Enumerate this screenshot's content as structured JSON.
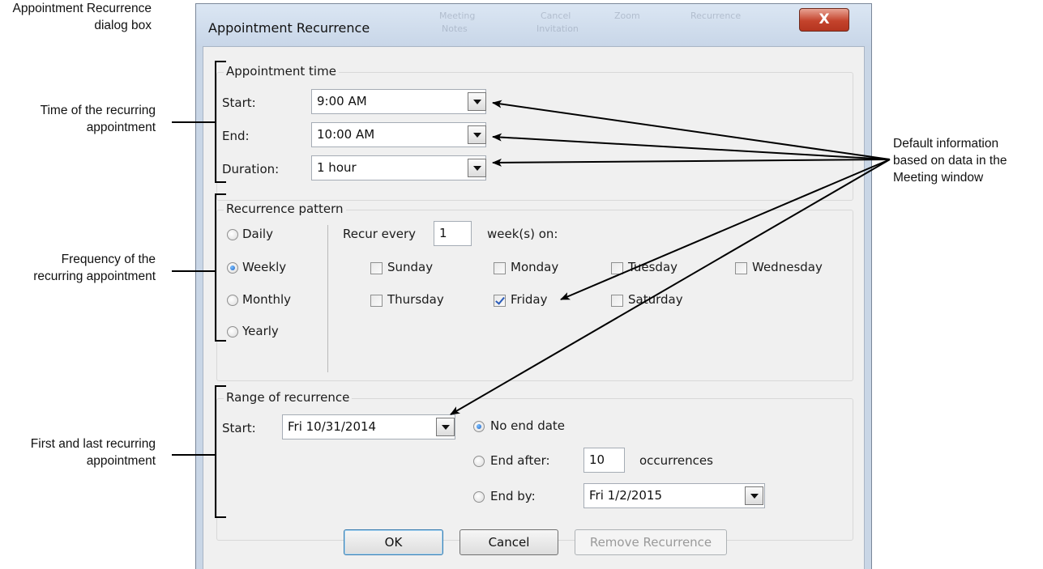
{
  "annotations": {
    "dialog_name": [
      "Appointment Recurrence",
      "dialog box"
    ],
    "time": [
      "Time of the recurring",
      "appointment"
    ],
    "frequency": [
      "Frequency of the",
      "recurring appointment"
    ],
    "range": [
      "First and last recurring",
      "appointment"
    ],
    "default_info": [
      "Default information",
      "based on data in the",
      "Meeting window"
    ]
  },
  "background_ribbon": [
    "Meeting",
    "Notes",
    "Cancel",
    "Invitation",
    "Zoom",
    "Recurrence"
  ],
  "dialog": {
    "title": "Appointment Recurrence",
    "close_label": "X",
    "appointment_time": {
      "group_label": "Appointment time",
      "start_label": "Start:",
      "start_value": "9:00 AM",
      "end_label": "End:",
      "end_value": "10:00 AM",
      "duration_label": "Duration:",
      "duration_value": "1 hour"
    },
    "recurrence_pattern": {
      "group_label": "Recurrence pattern",
      "options": [
        "Daily",
        "Weekly",
        "Monthly",
        "Yearly"
      ],
      "selected": "Weekly",
      "recur_every_label": "Recur every",
      "recur_every_value": "1",
      "weeks_on_label": "week(s) on:",
      "days": [
        {
          "label": "Sunday",
          "checked": false
        },
        {
          "label": "Monday",
          "checked": false
        },
        {
          "label": "Tuesday",
          "checked": false
        },
        {
          "label": "Wednesday",
          "checked": false
        },
        {
          "label": "Thursday",
          "checked": false
        },
        {
          "label": "Friday",
          "checked": true
        },
        {
          "label": "Saturday",
          "checked": false
        }
      ]
    },
    "range_of_recurrence": {
      "group_label": "Range of recurrence",
      "start_label": "Start:",
      "start_value": "Fri 10/31/2014",
      "no_end_label": "No end date",
      "end_after_label": "End after:",
      "end_after_value": "10",
      "occurrences_label": "occurrences",
      "end_by_label": "End by:",
      "end_by_value": "Fri 1/2/2015",
      "selected": "No end date"
    },
    "buttons": {
      "ok": "OK",
      "cancel": "Cancel",
      "remove": "Remove Recurrence"
    }
  },
  "colors": {
    "title_bar": "#c8d6e8",
    "close_button": "#c4432c",
    "client_bg": "#f0f0f0",
    "radio_selected": "#1f62c4"
  }
}
